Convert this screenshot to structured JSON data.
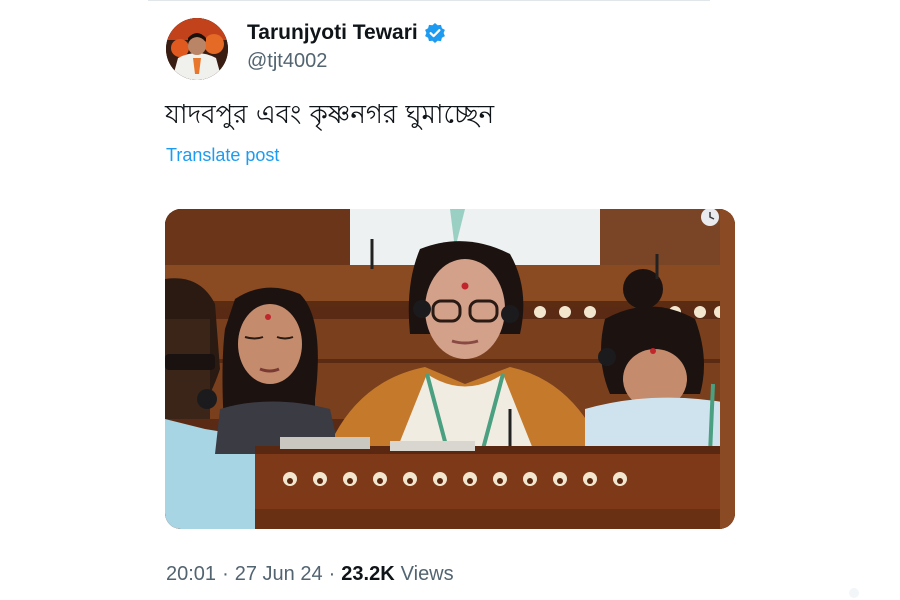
{
  "post": {
    "author": {
      "display_name": "Tarunjyoti Tewari",
      "handle": "@tjt4002",
      "verified": true,
      "avatar_icon": "profile-photo"
    },
    "text": "যাদবপুর এবং কৃষ্ণনগর ঘুমাচ্ছেন",
    "translate_label": "Translate post",
    "media": {
      "type": "photo",
      "description_icon": "parliament-photo"
    },
    "meta": {
      "time": "20:01",
      "separator": "·",
      "date": "27 Jun 24",
      "views_count": "23.2K",
      "views_label": "Views"
    }
  },
  "colors": {
    "text_primary": "#0f1419",
    "text_secondary": "#536471",
    "link": "#1d9bf0",
    "verified_badge": "#1d9bf0"
  }
}
